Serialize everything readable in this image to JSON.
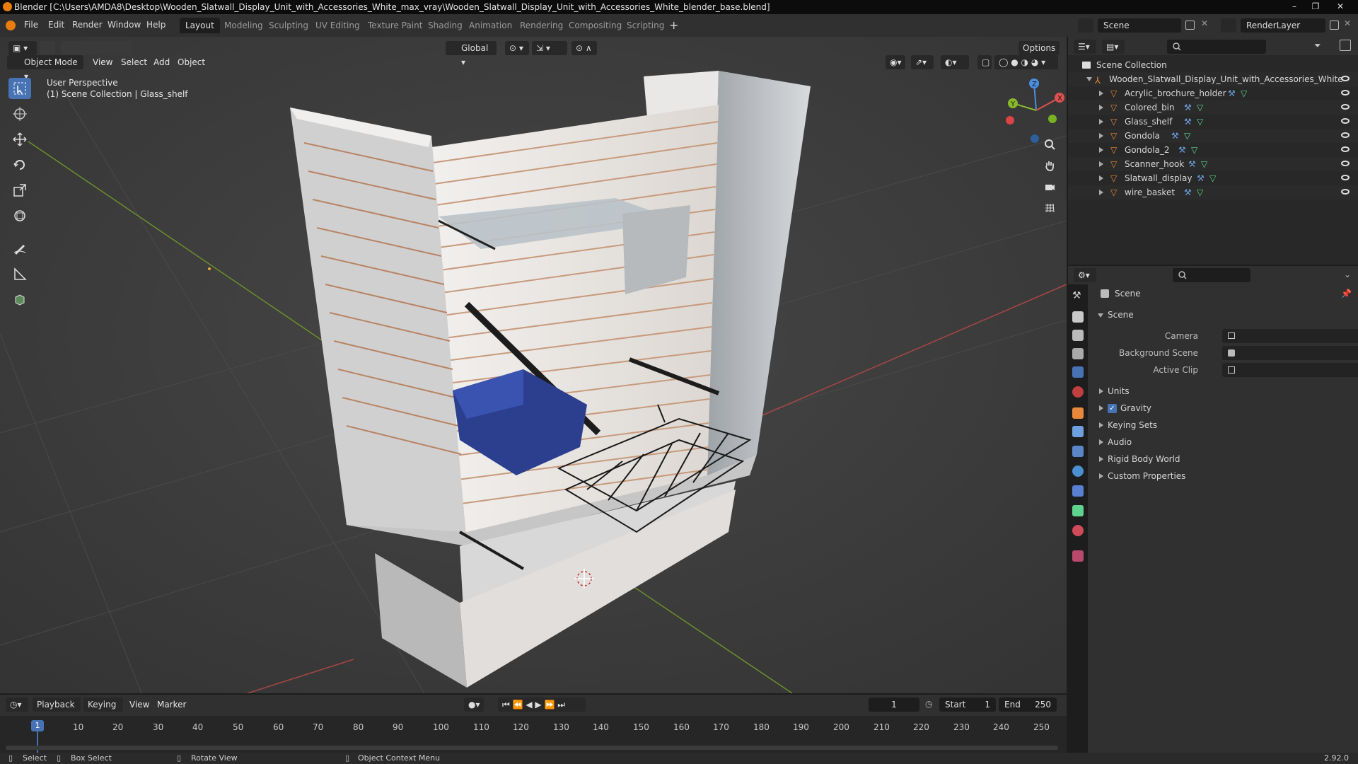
{
  "titlebar": {
    "title": "Blender [C:\\Users\\AMDA8\\Desktop\\Wooden_Slatwall_Display_Unit_with_Accessories_White_max_vray\\Wooden_Slatwall_Display_Unit_with_Accessories_White_blender_base.blend]",
    "minimize": "–",
    "maximize": "❐",
    "close": "✕"
  },
  "menubar": {
    "menus": [
      "File",
      "Edit",
      "Render",
      "Window",
      "Help"
    ],
    "workspaces": [
      "Layout",
      "Modeling",
      "Sculpting",
      "UV Editing",
      "Texture Paint",
      "Shading",
      "Animation",
      "Rendering",
      "Compositing",
      "Scripting"
    ],
    "add_tab": "+",
    "scene": "Scene",
    "view_layer": "RenderLayer"
  },
  "viewport": {
    "mode": "Object Mode",
    "menus": [
      "View",
      "Select",
      "Add",
      "Object"
    ],
    "transform_orientation": "Global",
    "options": "Options",
    "perspective": "User Perspective",
    "collection_info": "(1) Scene Collection | Glass_shelf",
    "gizmo_labels": {
      "x": "X",
      "y": "Y",
      "z": "Z"
    }
  },
  "outliner": {
    "root": "Scene Collection",
    "collection": "Wooden_Slatwall_Display_Unit_with_Accessories_White",
    "objects": [
      "Acrylic_brochure_holder",
      "Colored_bin",
      "Glass_shelf",
      "Gondola",
      "Gondola_2",
      "Scanner_hook",
      "Slatwall_display",
      "wire_basket"
    ]
  },
  "properties": {
    "breadcrumb": "Scene",
    "panel_title": "Scene",
    "fields": [
      {
        "label": "Camera"
      },
      {
        "label": "Background Scene"
      },
      {
        "label": "Active Clip"
      }
    ],
    "sections": [
      "Units",
      "Gravity",
      "Keying Sets",
      "Audio",
      "Rigid Body World",
      "Custom Properties"
    ],
    "gravity_checked": true
  },
  "timeline": {
    "menus": [
      "Playback",
      "Keying",
      "View",
      "Marker"
    ],
    "current_frame": "1",
    "start_label": "Start",
    "start_value": "1",
    "end_label": "End",
    "end_value": "250",
    "ticks": [
      "1",
      "10",
      "20",
      "30",
      "40",
      "50",
      "60",
      "70",
      "80",
      "90",
      "100",
      "110",
      "120",
      "130",
      "140",
      "150",
      "160",
      "170",
      "180",
      "190",
      "200",
      "210",
      "220",
      "230",
      "240",
      "250"
    ]
  },
  "statusbar": {
    "select": "Select",
    "box_select": "Box Select",
    "rotate_view": "Rotate View",
    "context_menu": "Object Context Menu",
    "version": "2.92.0"
  },
  "colors": {
    "accent": "#4772b3",
    "active_tab": "#1d1d1d",
    "panel": "#303030",
    "viewport_bg": "#3d3d3d",
    "object_orange": "#e8883a",
    "mesh_green": "#5fd38d",
    "x_axis": "#e05050",
    "y_axis": "#89b82c",
    "z_axis": "#4a8fe0"
  }
}
